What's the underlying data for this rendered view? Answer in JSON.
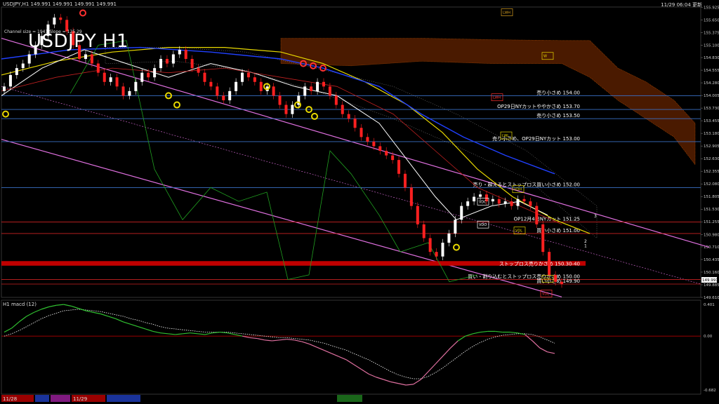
{
  "header": {
    "title_line": "USDJPY,H1  149.991 149.991 149.991 149.991",
    "big_title": "USDJPY H1",
    "channel_info": "Channel size = 1941 Slope = 125.29",
    "datetime": "11/29 06:04 更新"
  },
  "macd_panel": {
    "label": "H1  macd (12)",
    "levels": [
      {
        "value": 0.401,
        "label": "0.401"
      },
      {
        "value": 0.0,
        "label": "0.00"
      },
      {
        "value": -0.682,
        "label": "-0.682"
      }
    ]
  },
  "date_labels": [
    "11/28",
    "11/29"
  ],
  "price_axis": {
    "ymin": 149.61,
    "ymax": 155.93,
    "ticks": [
      "155.925",
      "155.650",
      "155.375",
      "155.100",
      "154.830",
      "154.555",
      "154.280",
      "154.005",
      "153.730",
      "153.455",
      "153.180",
      "152.905",
      "152.630",
      "152.355",
      "152.080",
      "151.805",
      "151.530",
      "151.255",
      "150.980",
      "150.710",
      "150.435",
      "150.160",
      "149.885",
      "149.610"
    ],
    "current_price": "149.991"
  },
  "levels": [
    {
      "price": 154.0,
      "label": "売り小さめ 154.00",
      "color": "#3a6fc4",
      "text_color": "#ffffff"
    },
    {
      "price": 153.7,
      "label": "OP29日NYカットややかさめ 153.70",
      "color": "#3a6fc4",
      "text_color": "#ffffff"
    },
    {
      "price": 153.5,
      "label": "売り小さめ 153.50",
      "color": "#3a6fc4",
      "text_color": "#ffffff"
    },
    {
      "price": 153.0,
      "label": "売り小さめ、OP29日NYカット 153.00",
      "color": "#3a6fc4",
      "text_color": "#ffffff"
    },
    {
      "price": 152.0,
      "label": "売り・超えるとストップロス買い小さめ 152.00",
      "color": "#3a6fc4",
      "text_color": "#ffffff"
    },
    {
      "price": 151.25,
      "label": "OP12月4日NYカット 151.25",
      "color": "#cc2222",
      "text_color": "#ffffff"
    },
    {
      "price": 151.0,
      "label": "買い小さめ 151.00",
      "color": "#cc2222",
      "text_color": "#ffffff"
    },
    {
      "price": 150.0,
      "label": "買い・割り込むとストップロス売りかさめ 150.00",
      "color": "#cc2222",
      "text_color": "#ffffff"
    },
    {
      "price": 149.9,
      "label": "買い小さめ 149.90",
      "color": "#cc2222",
      "text_color": "#ffffff"
    }
  ],
  "stop_band": {
    "from": 150.3,
    "to": 150.4,
    "label": "ストップロス売りかさめ 150.30-40",
    "color": "#c00000"
  },
  "box_labels": [
    "LWH",
    "LWH",
    "LWL",
    "VDH",
    "VDL",
    "VDC",
    "VDO",
    "VDL",
    "W",
    "VDH"
  ],
  "channel_numbers": [
    "3",
    "2",
    "1"
  ],
  "colors": {
    "bull": "#ffffff",
    "bear": "#ff2020",
    "ma_fast": "#ffffff",
    "ma_mid": "#e8d800",
    "ma_slow": "#2040ff",
    "chikou": "#20a020",
    "channel": "#e070e0",
    "cloud": "#c05000",
    "macd": "#e070a0",
    "signal": "#ffffff",
    "zero": "#b00000"
  },
  "chart_data": {
    "type": "candlestick",
    "title": "USDJPY H1",
    "ylim": [
      149.61,
      155.93
    ],
    "close": [
      154.2,
      154.45,
      154.6,
      154.7,
      154.9,
      155.1,
      155.3,
      155.55,
      155.7,
      155.65,
      155.4,
      155.1,
      154.8,
      154.9,
      154.7,
      154.5,
      154.3,
      154.4,
      154.2,
      154.0,
      154.1,
      154.3,
      154.5,
      154.4,
      154.6,
      154.8,
      154.7,
      154.9,
      155.0,
      154.8,
      154.6,
      154.5,
      154.3,
      154.2,
      154.0,
      153.9,
      154.1,
      154.3,
      154.5,
      154.4,
      154.3,
      154.1,
      154.2,
      154.0,
      153.8,
      153.6,
      153.8,
      154.0,
      154.2,
      154.1,
      154.3,
      154.2,
      154.0,
      153.8,
      153.6,
      153.5,
      153.3,
      153.1,
      153.0,
      152.9,
      152.8,
      152.7,
      152.6,
      152.3,
      152.0,
      151.6,
      151.2,
      150.9,
      150.6,
      150.5,
      150.8,
      151.0,
      151.3,
      151.6,
      151.7,
      151.8,
      151.85,
      151.7,
      151.75,
      151.65,
      151.7,
      151.6,
      151.75,
      151.7,
      151.6,
      151.2,
      150.6,
      150.1,
      149.95,
      149.9
    ]
  },
  "macd_data": {
    "macd": [
      0.05,
      0.1,
      0.18,
      0.25,
      0.3,
      0.34,
      0.37,
      0.39,
      0.4,
      0.38,
      0.35,
      0.32,
      0.3,
      0.28,
      0.25,
      0.22,
      0.18,
      0.15,
      0.12,
      0.09,
      0.06,
      0.04,
      0.03,
      0.02,
      0.03,
      0.04,
      0.03,
      0.02,
      0.04,
      0.05,
      0.04,
      0.02,
      0.0,
      -0.02,
      -0.03,
      -0.05,
      -0.06,
      -0.05,
      -0.04,
      -0.05,
      -0.07,
      -0.1,
      -0.14,
      -0.18,
      -0.22,
      -0.26,
      -0.3,
      -0.36,
      -0.42,
      -0.48,
      -0.52,
      -0.55,
      -0.58,
      -0.6,
      -0.62,
      -0.61,
      -0.55,
      -0.45,
      -0.35,
      -0.25,
      -0.15,
      -0.06,
      0.0,
      0.03,
      0.05,
      0.06,
      0.06,
      0.05,
      0.05,
      0.04,
      0.02,
      -0.06,
      -0.15,
      -0.2,
      -0.22
    ],
    "signal": [
      0.0,
      0.03,
      0.07,
      0.12,
      0.17,
      0.22,
      0.26,
      0.29,
      0.32,
      0.33,
      0.34,
      0.33,
      0.32,
      0.31,
      0.29,
      0.27,
      0.25,
      0.22,
      0.2,
      0.17,
      0.15,
      0.12,
      0.1,
      0.09,
      0.08,
      0.07,
      0.06,
      0.05,
      0.05,
      0.05,
      0.05,
      0.04,
      0.03,
      0.02,
      0.01,
      0.0,
      -0.01,
      -0.02,
      -0.02,
      -0.03,
      -0.04,
      -0.05,
      -0.07,
      -0.09,
      -0.12,
      -0.15,
      -0.18,
      -0.22,
      -0.26,
      -0.3,
      -0.35,
      -0.4,
      -0.45,
      -0.49,
      -0.52,
      -0.54,
      -0.54,
      -0.51,
      -0.46,
      -0.4,
      -0.33,
      -0.26,
      -0.19,
      -0.13,
      -0.08,
      -0.04,
      -0.01,
      0.01,
      0.02,
      0.03,
      0.03,
      0.02,
      -0.01,
      -0.05,
      -0.09
    ]
  }
}
